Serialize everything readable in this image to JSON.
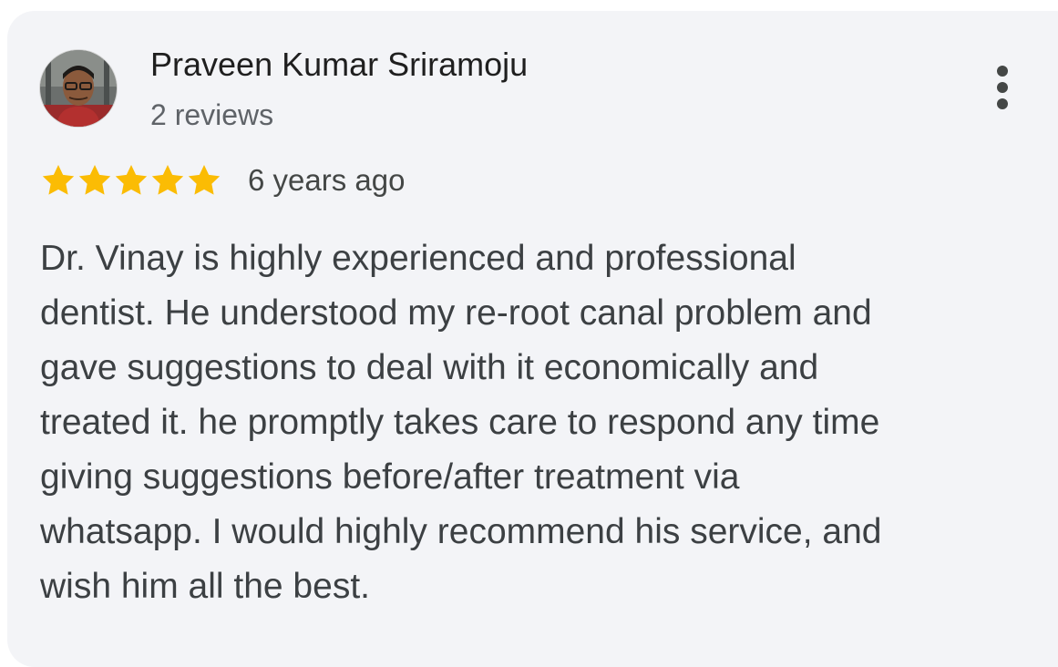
{
  "review": {
    "author": {
      "name": "Praveen Kumar Sriramoju",
      "reviews_count": "2 reviews",
      "avatar_icon": "profile-photo"
    },
    "rating": {
      "value": 5,
      "max": 5,
      "star_color": "#fbbc04",
      "star_icon": "star-icon"
    },
    "date": "6 years ago",
    "menu_icon": "more-vert-icon",
    "text_lines": [
      "Dr. Vinay is highly experienced and professional",
      "dentist. He understood my re-root canal problem and",
      "gave suggestions to deal with it economically and",
      "treated it. he promptly takes care to respond any time",
      "giving suggestions before/after treatment via",
      "whatsapp. I would highly recommend his service, and",
      "wish him all the best."
    ]
  },
  "colors": {
    "card_background": "#f3f4f7",
    "name_text": "#1f1f1f",
    "secondary_text": "#5f6368",
    "body_text": "#3c4043"
  }
}
